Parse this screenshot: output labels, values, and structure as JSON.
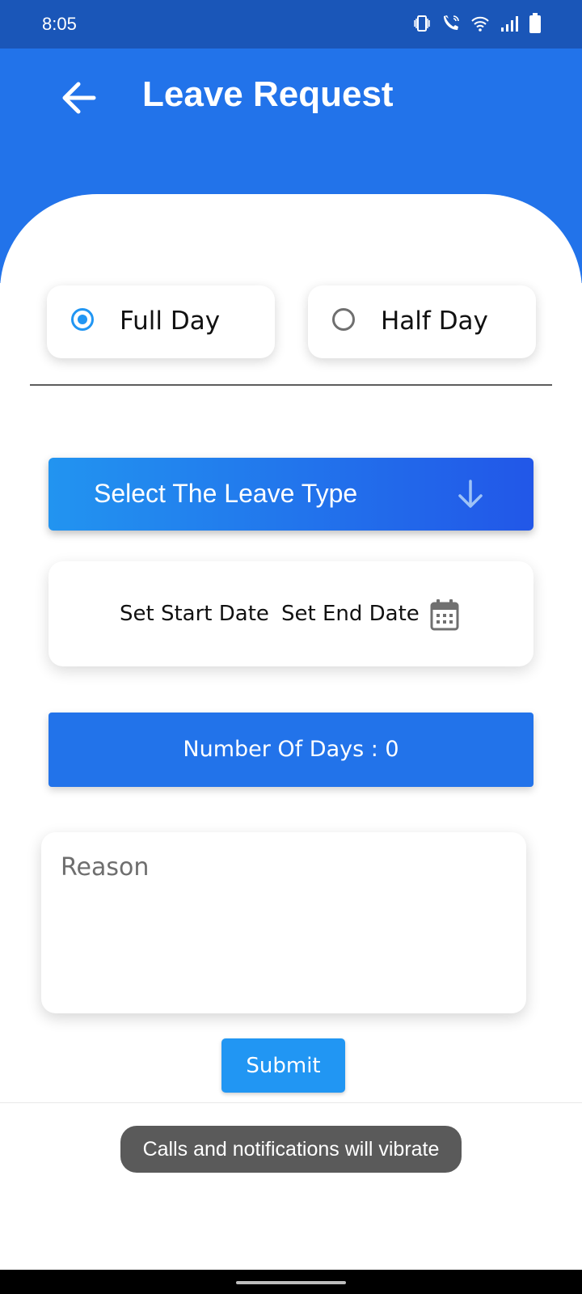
{
  "status_bar": {
    "time": "8:05",
    "icons": [
      "vibrate-icon",
      "wifi-calling-icon",
      "wifi-icon",
      "signal-icon",
      "battery-icon"
    ]
  },
  "header": {
    "title": "Leave Request",
    "back_icon": "arrow-left-icon",
    "color": "#2273ea"
  },
  "day_options": [
    {
      "label": "Full Day",
      "selected": true
    },
    {
      "label": "Half Day",
      "selected": false
    }
  ],
  "leave_type": {
    "label": "Select The Leave Type",
    "icon": "arrow-down-icon"
  },
  "dates": {
    "start_label": "Set Start Date",
    "end_label": "Set End Date",
    "icon": "calendar-icon"
  },
  "days": {
    "label": "Number Of Days : 0"
  },
  "reason": {
    "placeholder": "Reason",
    "value": ""
  },
  "submit": {
    "label": "Submit",
    "color": "#2196f3"
  },
  "toast": {
    "message": "Calls and notifications will vibrate"
  }
}
